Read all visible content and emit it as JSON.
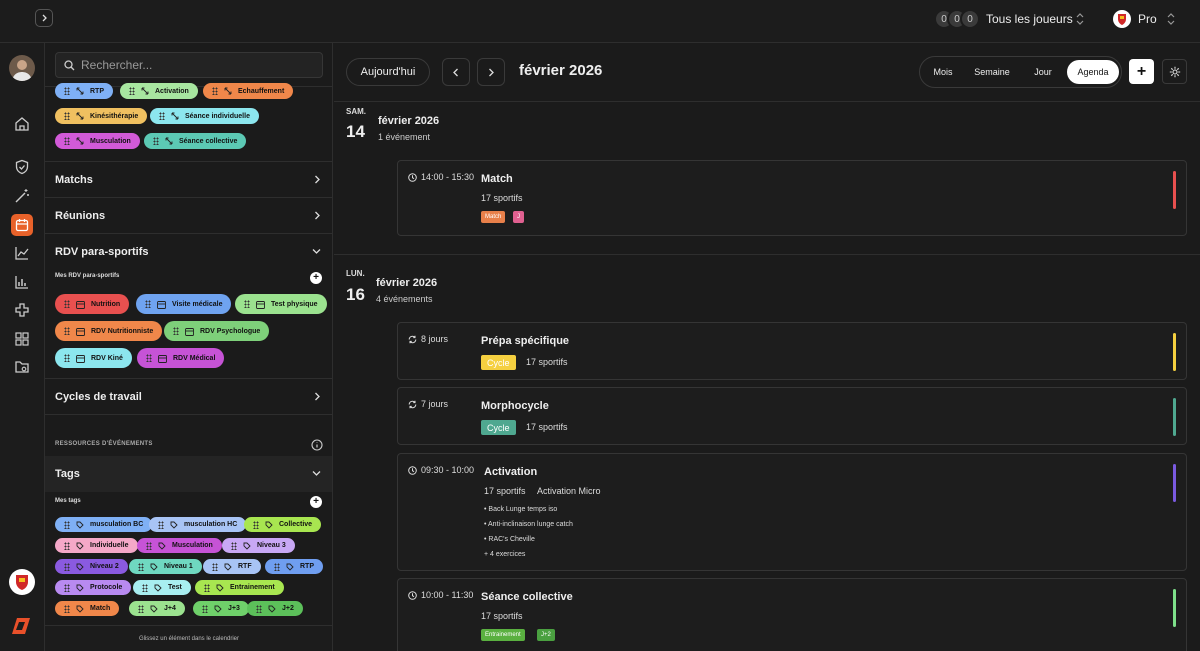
{
  "topbar": {
    "avatars": [
      "0",
      "0",
      "0"
    ],
    "players_label": "Tous les joueurs",
    "account_label": "Pro"
  },
  "sidebar": {
    "search_placeholder": "Rechercher...",
    "types": [
      {
        "label": "RTP",
        "color": "#7fb0f5"
      },
      {
        "label": "Activation",
        "color": "#a8e6a0"
      },
      {
        "label": "Echauffement",
        "color": "#f0874a"
      },
      {
        "label": "Kinésithérapie",
        "color": "#f0c060"
      },
      {
        "label": "Séance individuelle",
        "color": "#8ce6ee"
      },
      {
        "label": "Musculation",
        "color": "#d25ad8"
      },
      {
        "label": "Séance collective",
        "color": "#5cc9b4"
      }
    ],
    "sections": {
      "matchs": "Matchs",
      "reunions": "Réunions",
      "rdv": "RDV para-sportifs",
      "cycles": "Cycles de travail",
      "tags": "Tags"
    },
    "rdv_sub": "Mes RDV para-sportifs",
    "rdv_items": [
      {
        "label": "Nutrition",
        "color": "#e8504f"
      },
      {
        "label": "Visite médicale",
        "color": "#6fa3f0"
      },
      {
        "label": "Test physique",
        "color": "#9be28f"
      },
      {
        "label": "RDV Nutritionniste",
        "color": "#f0874a"
      },
      {
        "label": "RDV Psychologue",
        "color": "#7ed07a"
      },
      {
        "label": "RDV Kiné",
        "color": "#8ce6ee"
      },
      {
        "label": "RDV Médical",
        "color": "#c653d6"
      }
    ],
    "resources_label": "RESSOURCES D'ÉVÉNEMENTS",
    "tags_sub": "Mes tags",
    "tags": [
      {
        "label": "musculation BC",
        "color": "#7fb0f5"
      },
      {
        "label": "musculation HC",
        "color": "#a8c4f5"
      },
      {
        "label": "Collective",
        "color": "#a8e650"
      },
      {
        "label": "Individuelle",
        "color": "#f5a8c8"
      },
      {
        "label": "Musculation",
        "color": "#c653d6"
      },
      {
        "label": "Niveau 3",
        "color": "#c8a8f5"
      },
      {
        "label": "Niveau 2",
        "color": "#8a5ae0"
      },
      {
        "label": "Niveau 1",
        "color": "#6fd8c0"
      },
      {
        "label": "RTF",
        "color": "#a8c4f5"
      },
      {
        "label": "RTP",
        "color": "#6f9ef0"
      },
      {
        "label": "Protocole",
        "color": "#b88af0"
      },
      {
        "label": "Test",
        "color": "#a8eef0"
      },
      {
        "label": "Entrainement",
        "color": "#a8e650"
      },
      {
        "label": "Match",
        "color": "#f0874a"
      },
      {
        "label": "J+4",
        "color": "#9be28f"
      },
      {
        "label": "J+3",
        "color": "#6fd06a"
      },
      {
        "label": "J+2",
        "color": "#5cc05a"
      }
    ],
    "footer": "Glissez un élément dans le calendrier"
  },
  "main": {
    "today_label": "Aujourd'hui",
    "period": "février 2026",
    "views": [
      "Mois",
      "Semaine",
      "Jour",
      "Agenda"
    ],
    "active_view": "Agenda",
    "days": [
      {
        "dayname": "SAM.",
        "daynum": "14",
        "title": "février 2026",
        "count": "1 événement"
      },
      {
        "dayname": "LUN.",
        "daynum": "16",
        "title": "février 2026",
        "count": "4 événements"
      }
    ],
    "events": [
      {
        "time": "14:00 - 15:30",
        "title": "Match",
        "meta": "17 sportifs",
        "tags": [
          {
            "label": "Match",
            "color": "#e8804a"
          },
          {
            "label": "J",
            "color": "#e06090"
          }
        ],
        "bar": "#e8504f"
      },
      {
        "time": "8 jours",
        "title": "Prépa spécifique",
        "badge": "Cycle",
        "badge_color": "#f5d040",
        "meta": "17 sportifs",
        "bar": "#f5d040"
      },
      {
        "time": "7 jours",
        "title": "Morphocycle",
        "badge": "Cycle",
        "badge_color": "#4fa890",
        "meta": "17 sportifs",
        "bar": "#4fa890"
      },
      {
        "time": "09:30 - 10:00",
        "title": "Activation",
        "meta": "17 sportifs",
        "meta2": "Activation Micro",
        "exercises": [
          "• Back Lunge temps iso",
          "• Anti-inclinaison lunge catch",
          "• RAC's Cheville",
          "+ 4 exercices"
        ],
        "bar": "#7a5ae0"
      },
      {
        "time": "10:00 - 11:30",
        "title": "Séance collective",
        "meta": "17 sportifs",
        "tags": [
          {
            "label": "Entrainement",
            "color": "#5ab040"
          },
          {
            "label": "J+2",
            "color": "#4aa040"
          }
        ],
        "bar": "#7ee08a"
      }
    ]
  }
}
